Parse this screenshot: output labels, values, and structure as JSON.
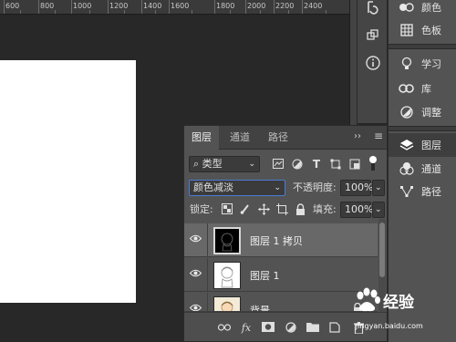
{
  "ruler": {
    "ticks": [
      "600",
      "800",
      "1000",
      "1200",
      "1400",
      "1600",
      "1800",
      "2000",
      "2200",
      "2400"
    ]
  },
  "icon_column": {
    "icons": [
      "history-icon",
      "3d-cube-icon",
      "info-icon"
    ]
  },
  "right_panel": {
    "items": [
      {
        "label": "颜色",
        "icon": "color-palette-icon"
      },
      {
        "label": "色板",
        "icon": "swatches-grid-icon"
      },
      {
        "label": "学习",
        "icon": "lightbulb-icon"
      },
      {
        "label": "库",
        "icon": "creative-cloud-icon"
      },
      {
        "label": "调整",
        "icon": "adjustment-circle-icon"
      },
      {
        "label": "图层",
        "icon": "layers-stack-icon"
      },
      {
        "label": "通道",
        "icon": "channels-circles-icon"
      },
      {
        "label": "路径",
        "icon": "paths-pen-icon"
      }
    ]
  },
  "layers_panel": {
    "tabs": [
      {
        "label": "图层",
        "active": true
      },
      {
        "label": "通道",
        "active": false
      },
      {
        "label": "路径",
        "active": false
      }
    ],
    "collapse_glyph": "››",
    "menu_glyph": "≡",
    "filter": {
      "search_glyph": "⌕",
      "label": "类型"
    },
    "blend_mode": "颜色减淡",
    "opacity_label": "不透明度:",
    "opacity_value": "100%",
    "lock_label": "锁定:",
    "fill_label": "填充:",
    "fill_value": "100%",
    "layers": [
      {
        "name": "图层 1 拷贝",
        "visible": true,
        "selected": true,
        "thumb": "dark"
      },
      {
        "name": "图层 1",
        "visible": true,
        "selected": false,
        "thumb": "light"
      },
      {
        "name": "背景",
        "visible": true,
        "selected": false,
        "thumb": "light",
        "locked": true
      }
    ],
    "footer_fx": "fx"
  },
  "watermark": {
    "brand": "经验",
    "url": "jingyan.baidu.com"
  },
  "colors": {
    "canvas": "#282828",
    "panel": "#535353",
    "selected_layer": "#686868",
    "blend_focus": "#4b7bd4"
  }
}
